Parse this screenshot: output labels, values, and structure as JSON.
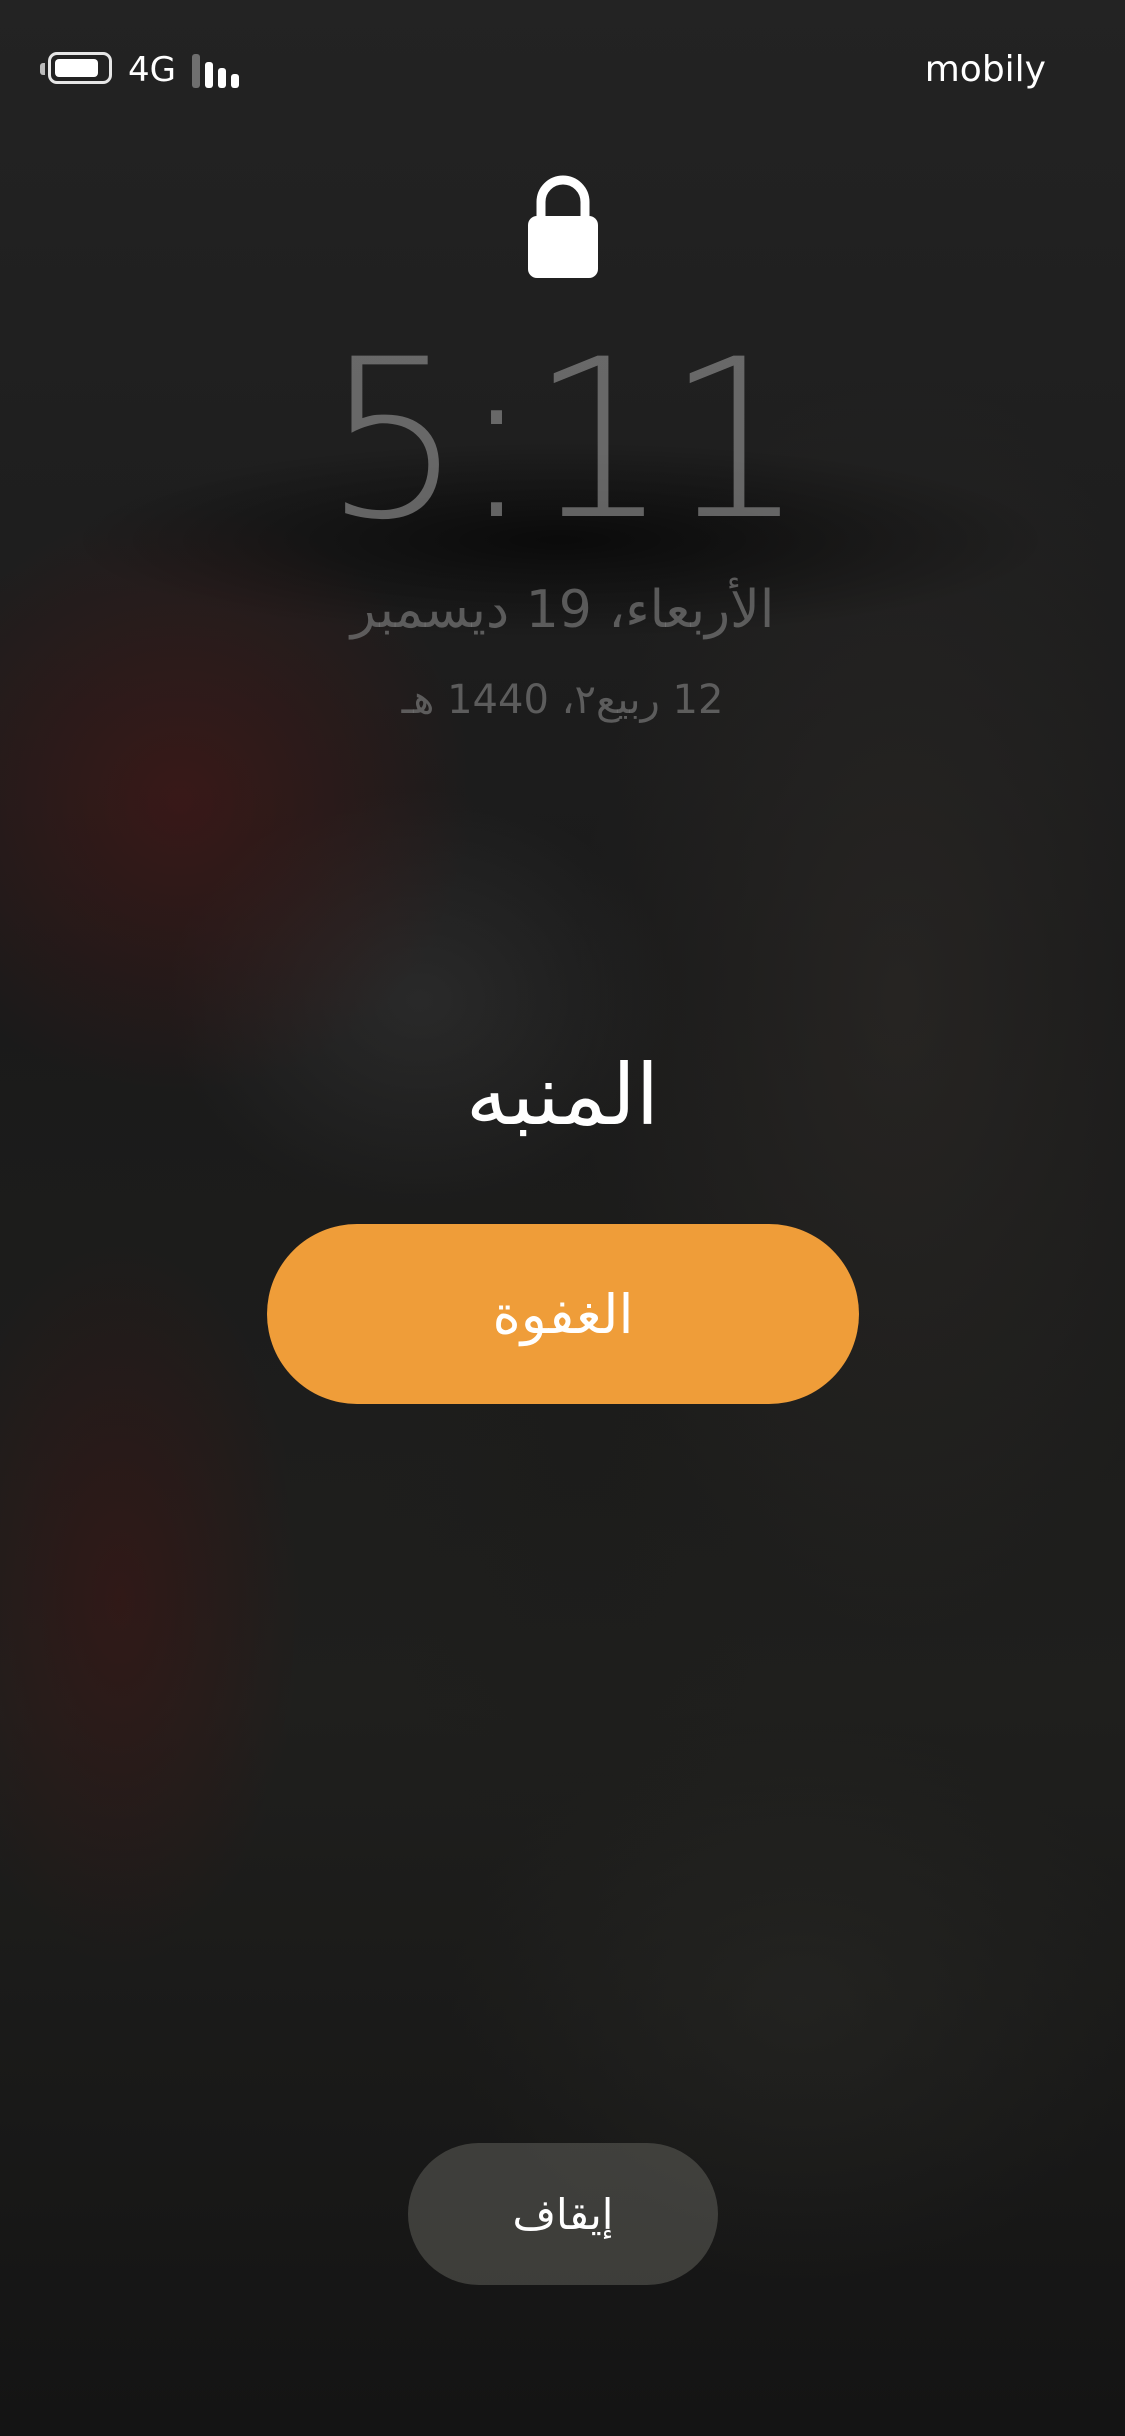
{
  "status_bar": {
    "network_type": "4G",
    "carrier": "mobily",
    "battery_level": 0.85,
    "signal_bars_active": 3,
    "signal_bars_total": 4
  },
  "lock_screen": {
    "time": "5:11",
    "date": "الأربعاء، 19 ديسمبر",
    "hijri_date": "12 ربيع٢، 1440 هـ"
  },
  "alarm": {
    "label": "المنبه",
    "snooze_label": "الغفوة",
    "stop_label": "إيقاف"
  },
  "colors": {
    "snooze_button": "#ef9d39",
    "stop_button": "#5f5f5a",
    "text": "#ffffff"
  },
  "icons": {
    "lock": "lock-icon",
    "battery": "battery-icon",
    "signal": "signal-strength-icon"
  }
}
